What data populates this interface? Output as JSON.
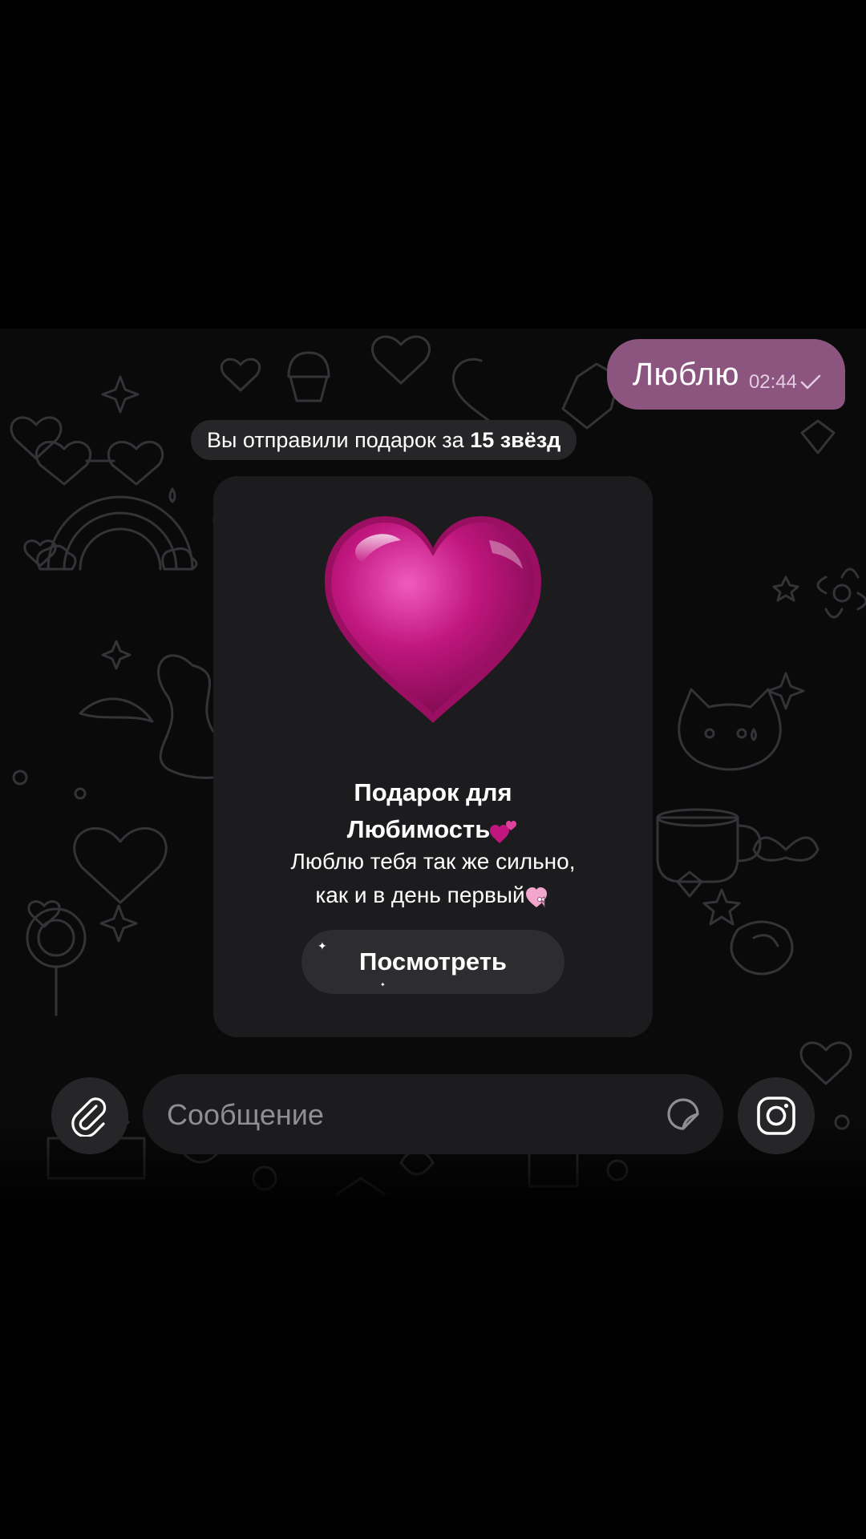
{
  "chat": {
    "outgoing_message": {
      "text": "Люблю",
      "time": "02:44",
      "status_icon": "single-check-icon"
    },
    "service_message": {
      "prefix": "Вы отправили подарок за ",
      "amount": "15 звёзд"
    },
    "gift": {
      "icon": "pink-heart-icon",
      "title_line1": "Подарок для",
      "title_line2": "Любимость",
      "title_emoji": "two-hearts-icon",
      "desc_line1": "Люблю тебя так же сильно,",
      "desc_line2": "как и в день первый",
      "desc_emoji": "heart-with-ribbon-icon",
      "view_button": "Посмотреть"
    }
  },
  "input_bar": {
    "attach_icon": "paperclip-icon",
    "placeholder": "Сообщение",
    "sticker_icon": "sticker-icon",
    "camera_icon": "instagram-camera-icon"
  },
  "colors": {
    "outgoing_bubble": "#8c5580",
    "heart": "#c0167e",
    "background": "#0a0a0b"
  }
}
